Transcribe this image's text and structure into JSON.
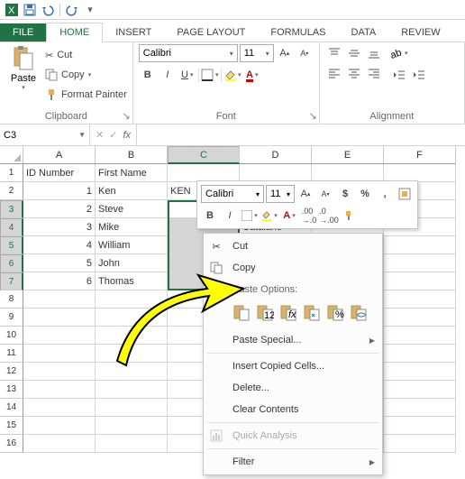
{
  "qat": {
    "icons": [
      "excel",
      "save",
      "undo",
      "redo"
    ]
  },
  "tabs": {
    "file": "FILE",
    "items": [
      "HOME",
      "INSERT",
      "PAGE LAYOUT",
      "FORMULAS",
      "DATA",
      "REVIEW"
    ],
    "active": 0
  },
  "ribbon": {
    "clipboard": {
      "title": "Clipboard",
      "paste": "Paste",
      "cut": "Cut",
      "copy": "Copy",
      "fmt": "Format Painter"
    },
    "font": {
      "title": "Font",
      "name": "Calibri",
      "size": "11"
    },
    "alignment": {
      "title": "Alignment"
    }
  },
  "namebox": "C3",
  "cols": [
    "A",
    "B",
    "C",
    "D",
    "E",
    "F"
  ],
  "rows": 16,
  "data": {
    "header": [
      "ID Number",
      "First Name"
    ],
    "rows": [
      [
        "1",
        "Ken"
      ],
      [
        "2",
        "Steve"
      ],
      [
        "3",
        "Mike"
      ],
      [
        "4",
        "William"
      ],
      [
        "5",
        "John"
      ],
      [
        "6",
        "Thomas"
      ]
    ],
    "c2": "KEN",
    "d4_peek": "Catalano"
  },
  "minitool": {
    "font": "Calibri",
    "size": "11"
  },
  "ctx": {
    "cut": "Cut",
    "copy": "Copy",
    "pastehdr": "Paste Options:",
    "pastespecial": "Paste Special...",
    "insert": "Insert Copied Cells...",
    "delete": "Delete...",
    "clear": "Clear Contents",
    "quick": "Quick Analysis",
    "filter": "Filter"
  }
}
